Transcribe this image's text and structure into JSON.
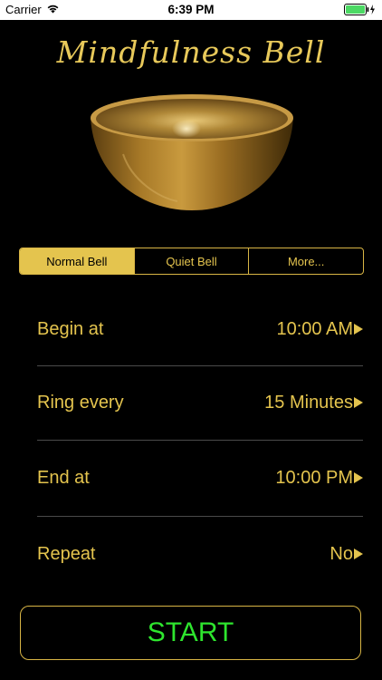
{
  "status_bar": {
    "carrier": "Carrier",
    "time": "6:39 PM",
    "wifi_icon": "wifi-icon",
    "battery_icon": "battery-charging-icon",
    "battery_color": "#4cd964"
  },
  "app": {
    "title": "Mindfulness Bell",
    "bowl_image": "singing-bowl-icon",
    "accent_color": "#e4c44e",
    "start_color": "#2ee52e"
  },
  "bell_selector": {
    "segments": [
      "Normal Bell",
      "Quiet Bell",
      "More..."
    ],
    "selected": "Normal Bell"
  },
  "settings": [
    {
      "label": "Begin at",
      "value": "10:00 AM"
    },
    {
      "label": "Ring every",
      "value": "15 Minutes"
    },
    {
      "label": "End at",
      "value": "10:00 PM"
    },
    {
      "label": "Repeat",
      "value": "No"
    }
  ],
  "start_button": {
    "label": "START"
  }
}
